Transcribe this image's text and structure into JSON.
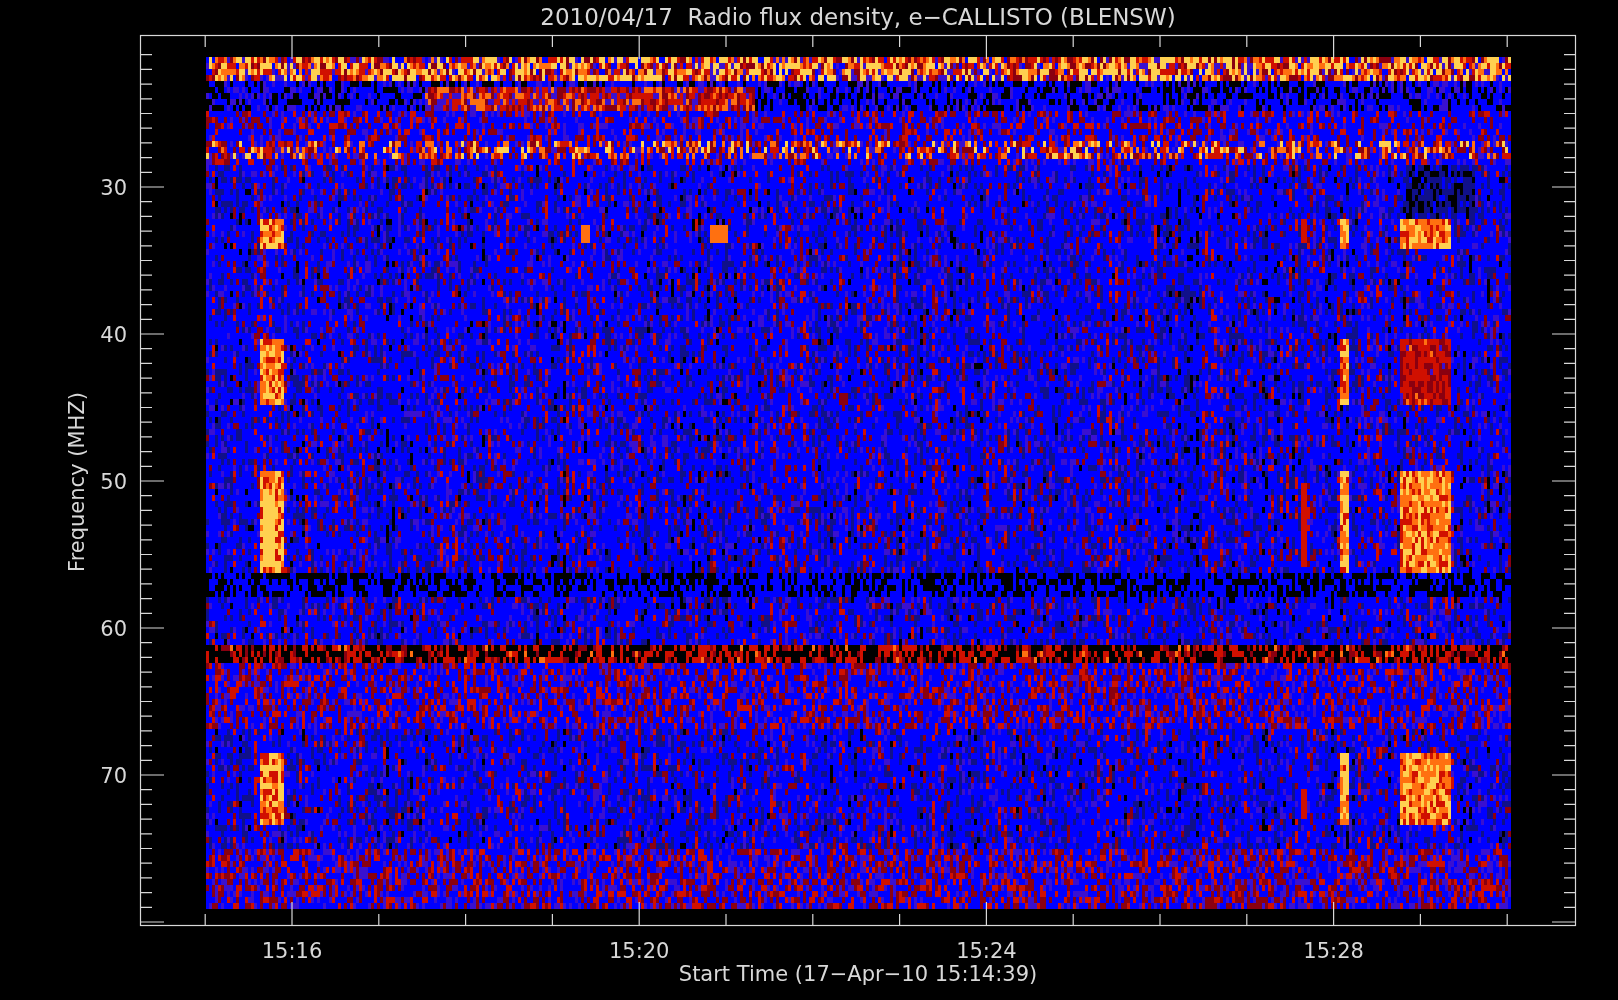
{
  "plot": {
    "title": "2010/04/17  Radio flux density, e−CALLISTO (BLENSW)",
    "xlabel": "Start Time (17−Apr−10 15:14:39)",
    "ylabel": "Frequency (MHZ)",
    "xticks": [
      "15:16",
      "15:20",
      "15:24",
      "15:28"
    ],
    "yticks": [
      "30",
      "40",
      "50",
      "60",
      "70"
    ]
  }
}
